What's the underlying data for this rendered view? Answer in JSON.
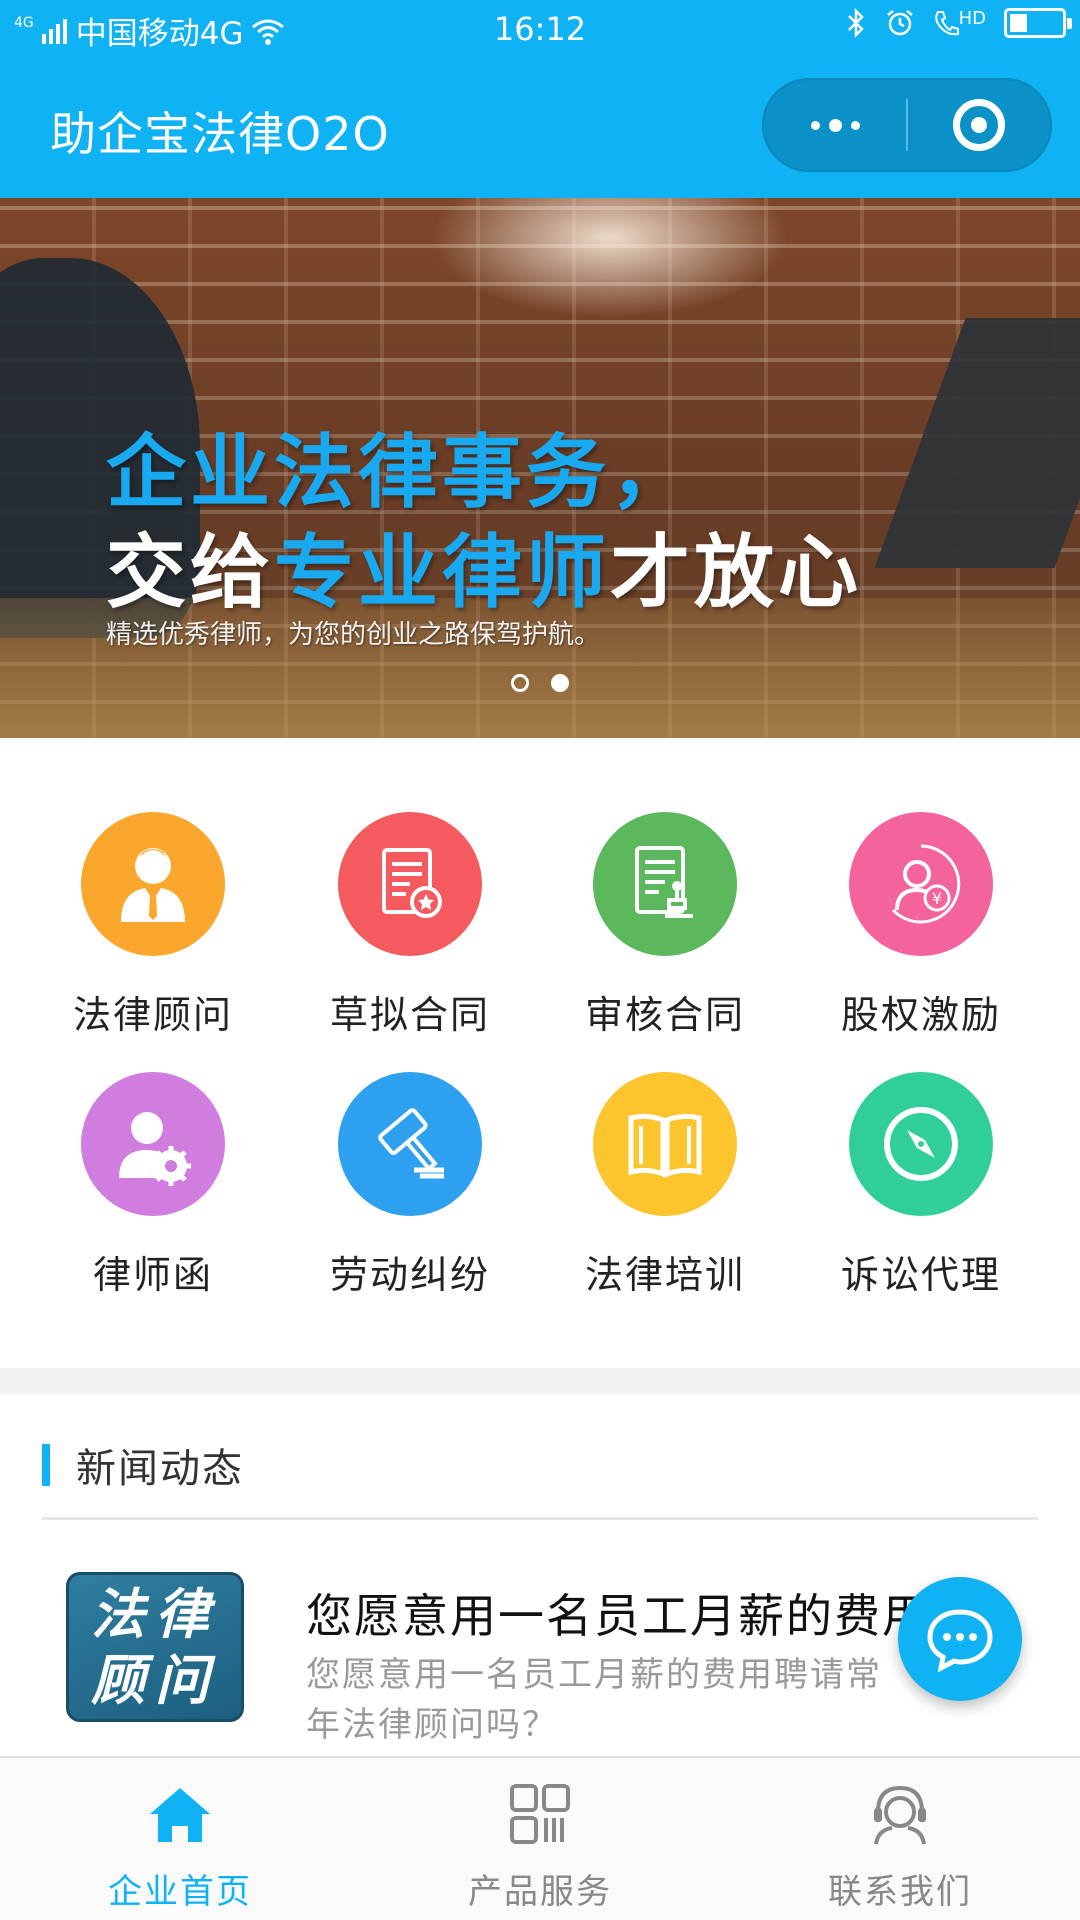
{
  "status_bar": {
    "signal": "4G",
    "carrier": "中国移动4G",
    "time": "16:12",
    "hd_label": "HD",
    "battery_level": 0.3
  },
  "nav": {
    "title": "助企宝法律O2O",
    "more_icon": "more-dots-icon",
    "close_icon": "target-circle-icon"
  },
  "banner": {
    "line1": "企业法律事务，",
    "line2_prefix": "交给",
    "line2_highlight": "专业律师",
    "line2_suffix": "才放心",
    "subtitle": "精选优秀律师，为您的创业之路保驾护航。",
    "slide_count": 2,
    "active_slide": 2
  },
  "services": [
    {
      "label": "法律顾问",
      "icon": "lawyer-icon",
      "color": "#fba62c"
    },
    {
      "label": "草拟合同",
      "icon": "draft-contract-icon",
      "color": "#f55a5e"
    },
    {
      "label": "审核合同",
      "icon": "review-contract-icon",
      "color": "#5cb85c"
    },
    {
      "label": "股权激励",
      "icon": "equity-incentive-icon",
      "color": "#f5639c"
    },
    {
      "label": "律师函",
      "icon": "lawyer-letter-icon",
      "color": "#d17de0"
    },
    {
      "label": "劳动纠纷",
      "icon": "gavel-icon",
      "color": "#2ea0f0"
    },
    {
      "label": "法律培训",
      "icon": "book-icon",
      "color": "#fcc52e"
    },
    {
      "label": "诉讼代理",
      "icon": "compass-icon",
      "color": "#30cf97"
    }
  ],
  "news": {
    "section_title": "新闻动态",
    "accent_color": "#0fb2f2",
    "items": [
      {
        "thumb_line1": "法律",
        "thumb_line2": "顾问",
        "headline": "您愿意用一名员工月薪的费用",
        "description": "您愿意用一名员工月薪的费用聘请常年法律顾问吗？"
      }
    ]
  },
  "fab": {
    "icon": "chat-bubble-icon"
  },
  "tabbar": {
    "active_color": "#0fb2f2",
    "tabs": [
      {
        "label": "企业首页",
        "icon": "home-icon",
        "active": true
      },
      {
        "label": "产品服务",
        "icon": "grid-apps-icon",
        "active": false
      },
      {
        "label": "联系我们",
        "icon": "customer-service-icon",
        "active": false
      }
    ]
  }
}
